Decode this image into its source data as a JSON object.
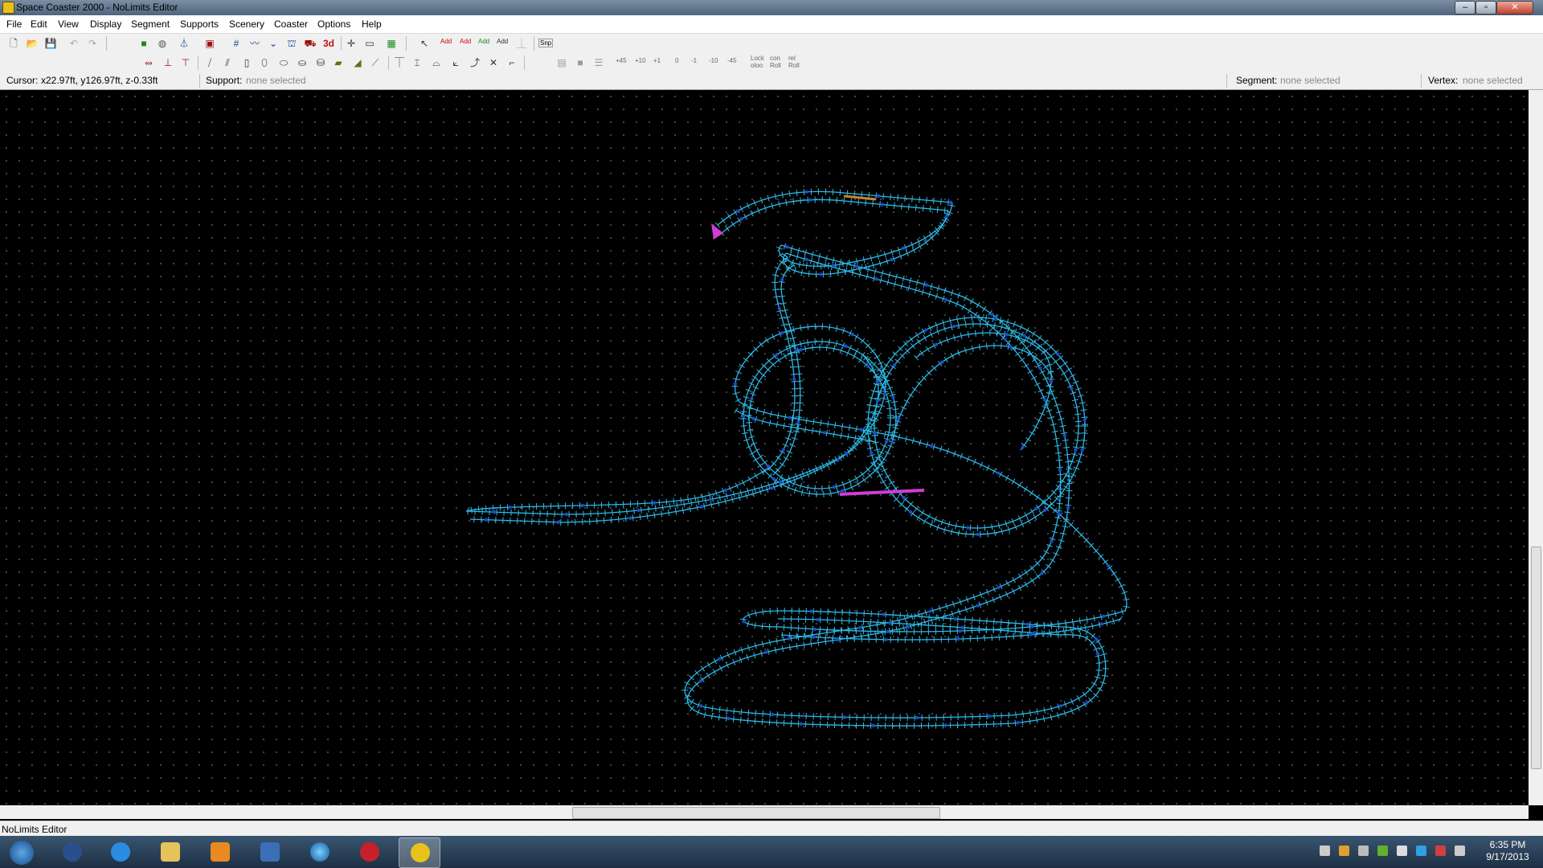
{
  "window": {
    "title": "Space Coaster 2000 - NoLimits Editor"
  },
  "menu": [
    "File",
    "Edit",
    "View",
    "Display",
    "Segment",
    "Supports",
    "Scenery",
    "Coaster",
    "Options",
    "Help"
  ],
  "toolbar": {
    "snap_label": "Snp",
    "add_labels": [
      "Add",
      "Add",
      "Add",
      "Add"
    ],
    "three_d_label": "3d",
    "rotate_labels": [
      "+45",
      "+10",
      "+1",
      "0",
      "-1",
      "-10",
      "-45"
    ],
    "lock_labels": [
      "Lock",
      "con",
      "rel"
    ],
    "roll_labels": [
      "oloo",
      "Roll",
      "Roll"
    ]
  },
  "info": {
    "cursor_label": "Cursor:",
    "cursor_value": "x22.97ft, y126.97ft, z-0.33ft",
    "support_label": "Support:",
    "support_value": "none selected",
    "segment_label": "Segment:",
    "segment_value": "none selected",
    "vertex_label": "Vertex:",
    "vertex_value": "none selected"
  },
  "statusbar": {
    "text": "NoLimits Editor"
  },
  "taskbar": {
    "time": "6:35 PM",
    "date": "9/17/2013",
    "pinned": [
      "start-orb",
      "hp-icon",
      "internet-explorer-icon",
      "folder-icon",
      "media-player-icon",
      "check-icon",
      "globe-icon",
      "red-app-icon",
      "nolimits-icon"
    ]
  },
  "track": {
    "rail_color": "#2fb9e6",
    "selected_color": "#d23cd6",
    "station_color": "#c9862a"
  }
}
